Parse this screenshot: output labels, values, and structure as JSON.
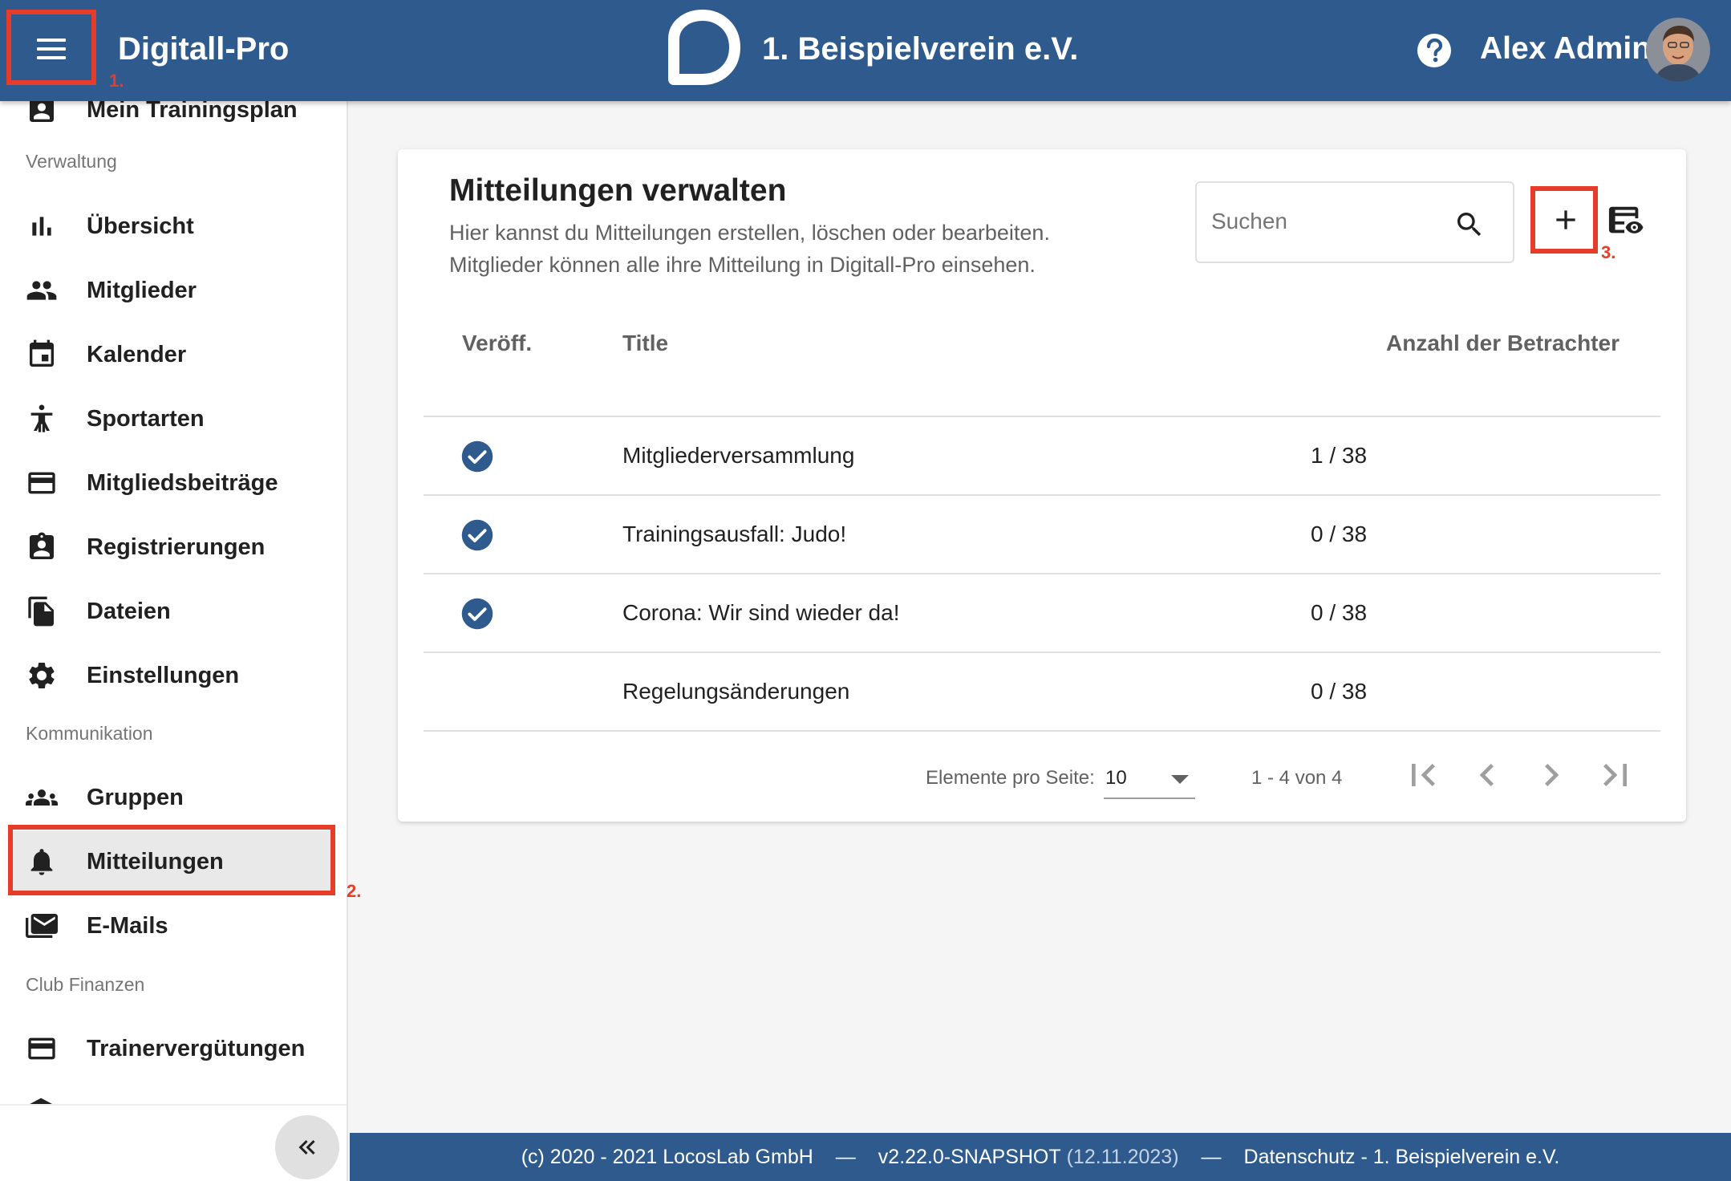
{
  "header": {
    "app_title": "Digitall-Pro",
    "club_name": "1. Beispielverein e.V.",
    "user_name": "Alex Admin",
    "bg_color": "#2e5a8e"
  },
  "sidebar": {
    "partial_item": "Mein Trainingsplan",
    "sections": {
      "verwaltung": "Verwaltung",
      "kommunikation": "Kommunikation",
      "finanzen": "Club Finanzen"
    },
    "items": {
      "uebersicht": "Übersicht",
      "mitglieder": "Mitglieder",
      "kalender": "Kalender",
      "sportarten": "Sportarten",
      "beitraege": "Mitgliedsbeiträge",
      "registrierungen": "Registrierungen",
      "dateien": "Dateien",
      "einstellungen": "Einstellungen",
      "gruppen": "Gruppen",
      "mitteilungen": "Mitteilungen",
      "emails": "E-Mails",
      "trainerverguetungen": "Trainervergütungen"
    },
    "active_item": "Mitteilungen"
  },
  "main": {
    "title": "Mitteilungen verwalten",
    "description_line1": "Hier kannst du Mitteilungen erstellen, löschen oder bearbeiten.",
    "description_line2": "Mitglieder können alle ihre Mitteilung in Digitall-Pro einsehen.",
    "search_placeholder": "Suchen",
    "columns": {
      "published": "Veröff.",
      "title": "Title",
      "viewers": "Anzahl der Betrachter"
    },
    "rows": [
      {
        "published": true,
        "title": "Mitgliederversammlung",
        "viewers": "1 / 38"
      },
      {
        "published": true,
        "title": "Trainingsausfall: Judo!",
        "viewers": "0 / 38"
      },
      {
        "published": true,
        "title": "Corona: Wir sind wieder da!",
        "viewers": "0 / 38"
      },
      {
        "published": false,
        "title": "Regelungsänderungen",
        "viewers": "0 / 38"
      }
    ],
    "pagination": {
      "per_page_label": "Elemente pro Seite:",
      "per_page_value": "10",
      "range": "1 - 4 von 4"
    }
  },
  "annotations": {
    "marker_1": "1.",
    "marker_2": "2.",
    "marker_3": "3.",
    "color": "#e63d2a"
  },
  "footer": {
    "copyright": "(c) 2020 - 2021 LocosLab GmbH",
    "separator": "—",
    "version": "v2.22.0-SNAPSHOT",
    "version_date": "(12.11.2023)",
    "privacy": "Datenschutz - 1. Beispielverein e.V."
  }
}
